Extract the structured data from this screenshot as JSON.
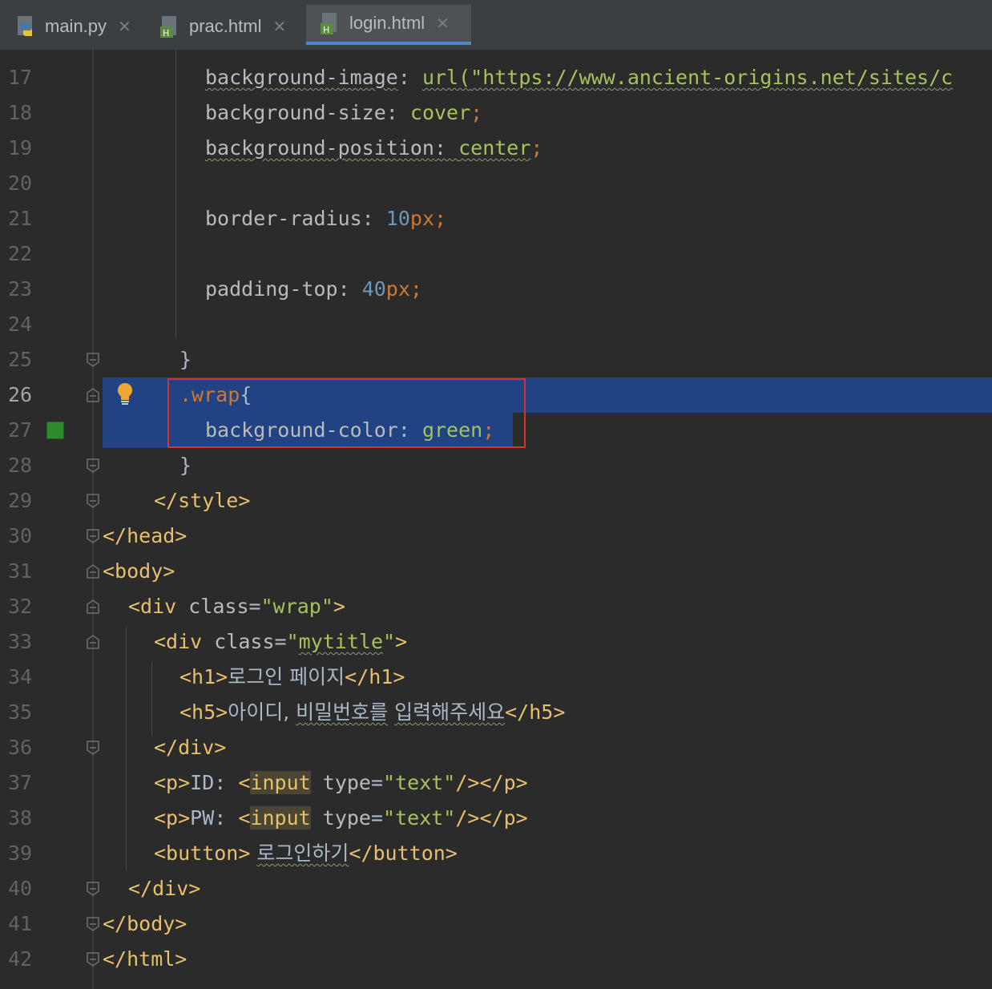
{
  "tabs": [
    {
      "label": "main.py",
      "icon": "python-file-icon",
      "active": false
    },
    {
      "label": "prac.html",
      "icon": "html-file-icon",
      "active": false
    },
    {
      "label": "login.html",
      "icon": "html-file-icon",
      "active": true
    }
  ],
  "tab_close_glyph": "✕",
  "colors": {
    "background": "#2b2b2b",
    "selection": "#214283",
    "tag": "#e8bf6a",
    "string": "#a5c25c",
    "number": "#6897bb",
    "keyword": "#cc7832",
    "highlight_box": "#d8322a",
    "color_swatch_green": "#2e8b2e"
  },
  "current_line": "26",
  "lines": [
    {
      "no": "17",
      "parts": [
        "background-image",
        ": ",
        "url(",
        "\"https://www.ancient-origins.net/sites/c"
      ]
    },
    {
      "no": "18",
      "parts": [
        "background-size",
        ": ",
        "cover",
        ";"
      ]
    },
    {
      "no": "19",
      "parts": [
        "background-position",
        ": ",
        "center",
        ";"
      ]
    },
    {
      "no": "20",
      "parts": []
    },
    {
      "no": "21",
      "parts": [
        "border-radius",
        ": ",
        "10",
        "px",
        ";"
      ]
    },
    {
      "no": "22",
      "parts": []
    },
    {
      "no": "23",
      "parts": [
        "padding-top",
        ": ",
        "40",
        "px",
        ";"
      ]
    },
    {
      "no": "24",
      "parts": []
    },
    {
      "no": "25",
      "parts": [
        "}"
      ]
    },
    {
      "no": "26",
      "parts": [
        ".wrap",
        "{"
      ]
    },
    {
      "no": "27",
      "parts": [
        "background-color",
        ": ",
        "green",
        ";"
      ]
    },
    {
      "no": "28",
      "parts": [
        "}"
      ]
    },
    {
      "no": "29",
      "parts": [
        "</style>"
      ]
    },
    {
      "no": "30",
      "parts": [
        "</head>"
      ]
    },
    {
      "no": "31",
      "parts": [
        "<body>"
      ]
    },
    {
      "no": "32",
      "parts": [
        "<div ",
        "class",
        "=",
        "\"wrap\"",
        ">"
      ]
    },
    {
      "no": "33",
      "parts": [
        "<div ",
        "class",
        "=",
        "\"",
        "mytitle",
        "\"",
        ">"
      ]
    },
    {
      "no": "34",
      "parts": [
        "<h1>",
        "로그인 페이지",
        "</h1>"
      ]
    },
    {
      "no": "35",
      "parts": [
        "<h5>",
        "아이디, ",
        "비밀번호를",
        " ",
        "입력해주세요",
        "</h5>"
      ]
    },
    {
      "no": "36",
      "parts": [
        "</div>"
      ]
    },
    {
      "no": "37",
      "parts": [
        "<p>",
        "ID: ",
        "<",
        "input",
        " ",
        "type",
        "=",
        "\"text\"",
        "/></p>"
      ]
    },
    {
      "no": "38",
      "parts": [
        "<p>",
        "PW: ",
        "<",
        "input",
        " ",
        "type",
        "=",
        "\"text\"",
        "/></p>"
      ]
    },
    {
      "no": "39",
      "parts": [
        "<button>",
        " ",
        "로그인하기",
        "</button>"
      ]
    },
    {
      "no": "40",
      "parts": [
        "</div>"
      ]
    },
    {
      "no": "41",
      "parts": [
        "</body>"
      ]
    },
    {
      "no": "42",
      "parts": [
        "</html>"
      ]
    }
  ]
}
